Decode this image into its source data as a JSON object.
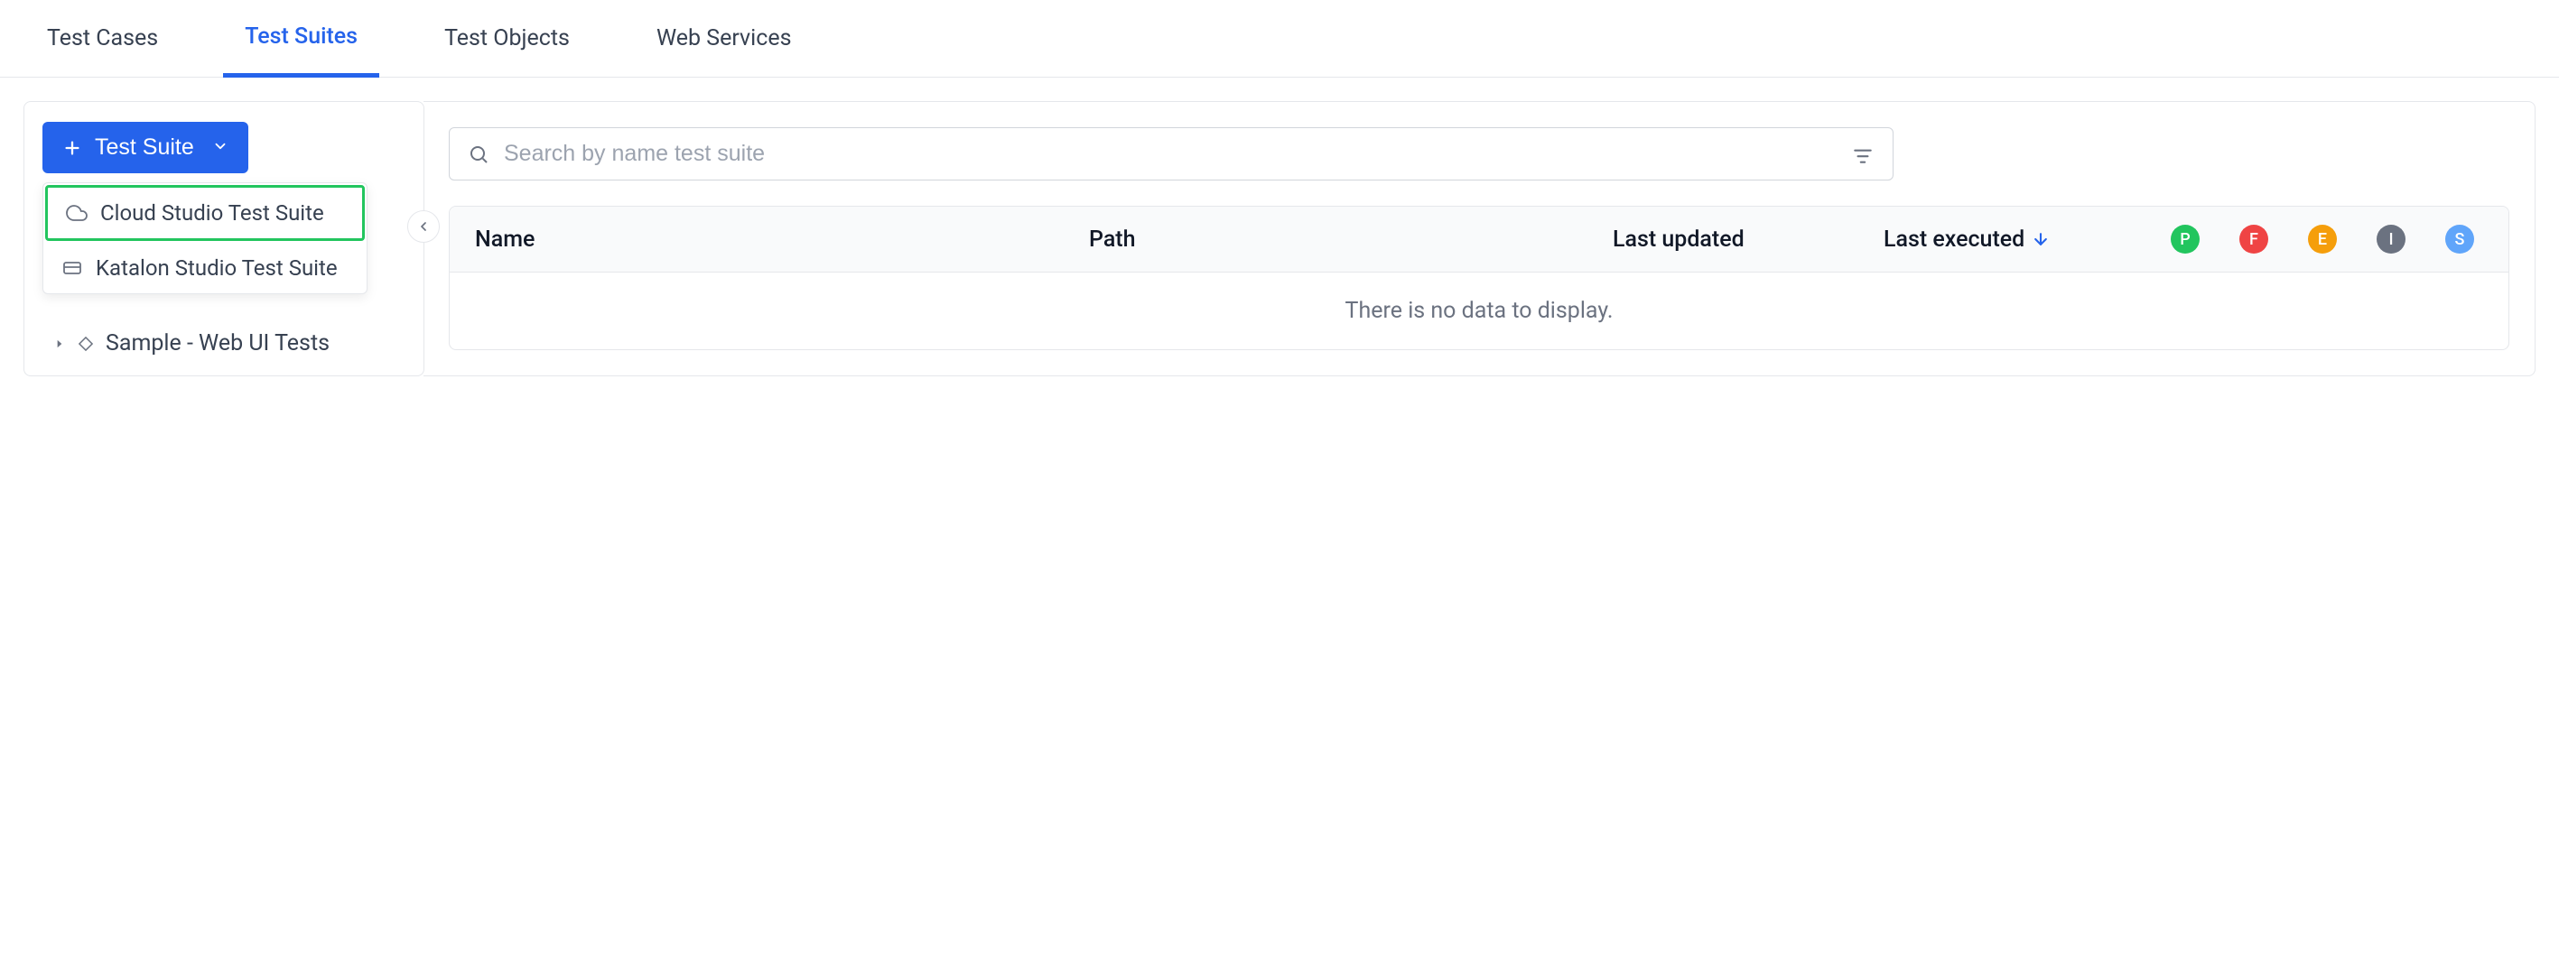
{
  "nav": {
    "tabs": [
      {
        "label": "Test Cases",
        "active": false
      },
      {
        "label": "Test Suites",
        "active": true
      },
      {
        "label": "Test Objects",
        "active": false
      },
      {
        "label": "Web Services",
        "active": false
      }
    ]
  },
  "sidebar": {
    "new_button_label": "Test Suite",
    "dropdown": [
      {
        "label": "Cloud Studio Test Suite",
        "icon": "cloud",
        "highlighted": true
      },
      {
        "label": "Katalon Studio Test Suite",
        "icon": "card",
        "highlighted": false
      }
    ],
    "tree": [
      {
        "label": "Sample - Web UI Tests"
      }
    ]
  },
  "search": {
    "placeholder": "Search by name test suite",
    "value": ""
  },
  "table": {
    "columns": {
      "name": "Name",
      "path": "Path",
      "updated": "Last updated",
      "executed": "Last executed"
    },
    "avatars": [
      {
        "letter": "P",
        "bg": "#22c55e"
      },
      {
        "letter": "F",
        "bg": "#ef4444"
      },
      {
        "letter": "E",
        "bg": "#f59e0b"
      },
      {
        "letter": "I",
        "bg": "#6b7280"
      },
      {
        "letter": "S",
        "bg": "#60a5fa"
      }
    ],
    "empty_message": "There is no data to display."
  }
}
